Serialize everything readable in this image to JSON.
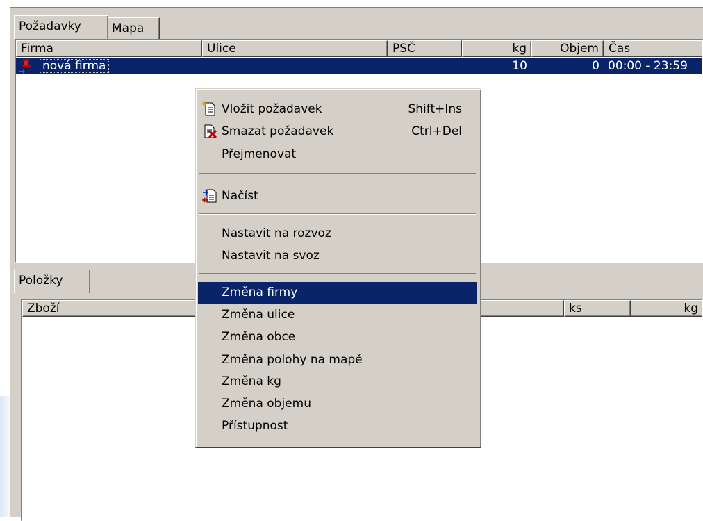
{
  "top_tabs": [
    "Požadavky",
    "Mapa"
  ],
  "requests": {
    "columns": [
      "Firma",
      "Ulice",
      "PSČ",
      "kg",
      "Objem",
      "Čas"
    ],
    "rows": [
      {
        "firma": "nová firma",
        "ulice": "",
        "psc": "",
        "kg": "10",
        "objem": "0",
        "cas": "00:00 - 23:59"
      }
    ]
  },
  "bottom_tabs": [
    "Položky"
  ],
  "items": {
    "columns": [
      "Zboží",
      "ks",
      "kg"
    ]
  },
  "context_menu": {
    "items": [
      {
        "label": "Vložit požadavek",
        "shortcut": "Shift+Ins",
        "icon": "insert-document-icon"
      },
      {
        "label": "Smazat požadavek",
        "shortcut": "Ctrl+Del",
        "icon": "delete-document-icon"
      },
      {
        "label": "Přejmenovat"
      },
      {
        "label": "Načíst",
        "icon": "load-document-icon"
      },
      {
        "label": "Nastavit na rozvoz"
      },
      {
        "label": "Nastavit na svoz"
      },
      {
        "label": "Změna firmy",
        "highlighted": true
      },
      {
        "label": "Změna ulice"
      },
      {
        "label": "Změna obce"
      },
      {
        "label": "Změna polohy na mapě"
      },
      {
        "label": "Změna kg"
      },
      {
        "label": "Změna objemu"
      },
      {
        "label": "Přístupnost"
      }
    ]
  },
  "colors": {
    "selection": "#0a246a",
    "face": "#d4d0c8"
  }
}
